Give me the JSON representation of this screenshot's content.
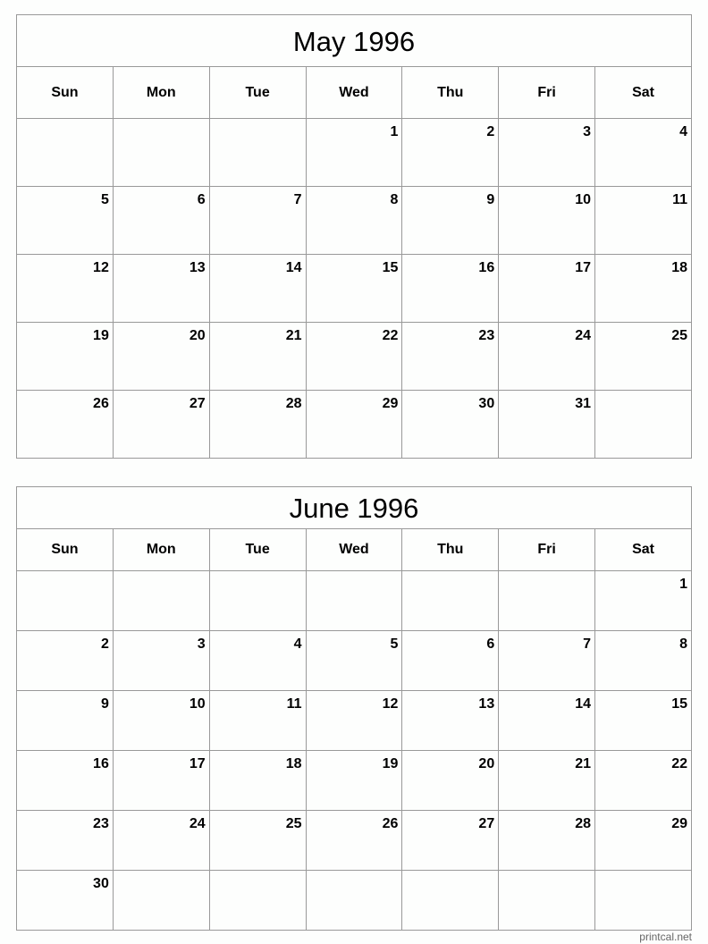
{
  "calendars": [
    {
      "title": "May 1996",
      "weekdays": [
        "Sun",
        "Mon",
        "Tue",
        "Wed",
        "Thu",
        "Fri",
        "Sat"
      ],
      "weeks": [
        [
          "",
          "",
          "",
          "1",
          "2",
          "3",
          "4"
        ],
        [
          "5",
          "6",
          "7",
          "8",
          "9",
          "10",
          "11"
        ],
        [
          "12",
          "13",
          "14",
          "15",
          "16",
          "17",
          "18"
        ],
        [
          "19",
          "20",
          "21",
          "22",
          "23",
          "24",
          "25"
        ],
        [
          "26",
          "27",
          "28",
          "29",
          "30",
          "31",
          ""
        ]
      ]
    },
    {
      "title": "June 1996",
      "weekdays": [
        "Sun",
        "Mon",
        "Tue",
        "Wed",
        "Thu",
        "Fri",
        "Sat"
      ],
      "weeks": [
        [
          "",
          "",
          "",
          "",
          "",
          "",
          "1"
        ],
        [
          "2",
          "3",
          "4",
          "5",
          "6",
          "7",
          "8"
        ],
        [
          "9",
          "10",
          "11",
          "12",
          "13",
          "14",
          "15"
        ],
        [
          "16",
          "17",
          "18",
          "19",
          "20",
          "21",
          "22"
        ],
        [
          "23",
          "24",
          "25",
          "26",
          "27",
          "28",
          "29"
        ],
        [
          "30",
          "",
          "",
          "",
          "",
          "",
          ""
        ]
      ]
    }
  ],
  "footer": {
    "site": "printcal.net"
  },
  "colors": {
    "grid": "#999999",
    "background": "#fdfefd",
    "text": "#000000"
  }
}
